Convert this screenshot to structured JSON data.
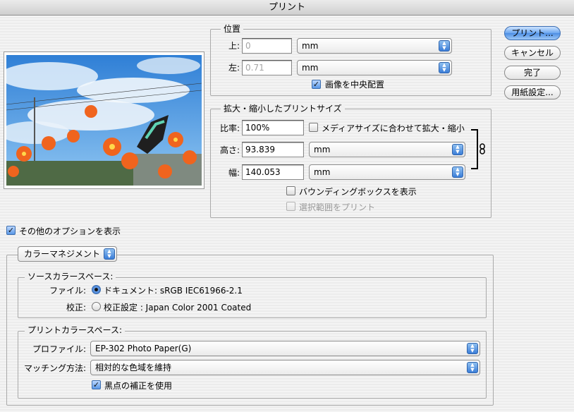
{
  "window": {
    "title": "プリント"
  },
  "buttons": {
    "print": "プリント...",
    "cancel": "キャンセル",
    "done": "完了",
    "page_setup": "用紙設定..."
  },
  "position": {
    "legend": "位置",
    "top_label": "上:",
    "top_value": "0",
    "top_unit": "mm",
    "left_label": "左:",
    "left_value": "0.71",
    "left_unit": "mm",
    "center_image": "画像を中央配置",
    "center_image_checked": true
  },
  "scaled": {
    "legend": "拡大・縮小したプリントサイズ",
    "scale_label": "比率:",
    "scale_value": "100%",
    "fit_media": "メディアサイズに合わせて拡大・縮小",
    "fit_media_checked": false,
    "height_label": "高さ:",
    "height_value": "93.839",
    "height_unit": "mm",
    "width_label": "幅:",
    "width_value": "140.053",
    "width_unit": "mm",
    "bounding_box": "バウンディングボックスを表示",
    "bounding_box_checked": false,
    "print_selection": "選択範囲をプリント",
    "print_selection_checked": false
  },
  "more_options": {
    "label": "その他のオプションを表示",
    "checked": true
  },
  "color_management": {
    "menu": "カラーマネジメント",
    "source": {
      "legend": "ソースカラースペース:",
      "file_label": "ファイル:",
      "file_value": "ドキュメント: sRGB IEC61966-2.1",
      "proof_label": "校正:",
      "proof_value": "校正設定 : Japan Color 2001 Coated"
    },
    "print": {
      "legend": "プリントカラースペース:",
      "profile_label": "プロファイル:",
      "profile_value": "EP-302 Photo Paper(G)",
      "intent_label": "マッチング方法:",
      "intent_value": "相対的な色域を維持",
      "bpc": "黒点の補正を使用",
      "bpc_checked": true
    }
  },
  "colors": {
    "accent": "#4d8ee3",
    "group_border": "#aaaaaa"
  }
}
